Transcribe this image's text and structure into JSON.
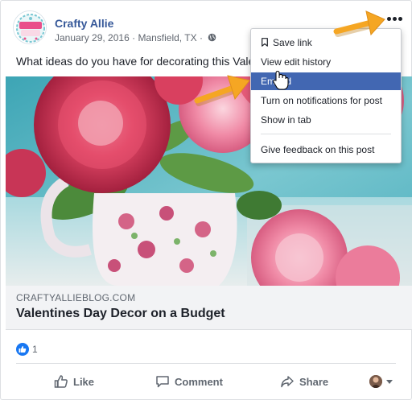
{
  "post": {
    "author": "Crafty Allie",
    "avatar_text": "Crafty Allie",
    "date": "January 29, 2016",
    "separator": "·",
    "location": "Mansfield, TX",
    "text": "What ideas do you have for decorating this Valentine's Day?",
    "more_icon": "more-dots-icon",
    "privacy_icon": "globe-icon"
  },
  "link_preview": {
    "domain": "CRAFTYALLIEBLOG.COM",
    "title": "Valentines Day Decor on a Budget"
  },
  "reactions": {
    "icon": "like-reaction-icon",
    "count": "1"
  },
  "actions": {
    "like": "Like",
    "comment": "Comment",
    "share": "Share"
  },
  "menu": {
    "items": [
      {
        "label": "Save link",
        "icon": "bookmark-icon"
      },
      {
        "label": "View edit history"
      },
      {
        "label": "Embed",
        "state": "hovered"
      },
      {
        "label": "Turn on notifications for post"
      },
      {
        "label": "Show in tab"
      },
      {
        "label": "Give feedback on this post"
      }
    ]
  },
  "colors": {
    "link_blue": "#365899",
    "menu_highlight": "#4267b2",
    "annotation_arrow": "#f5a623",
    "like_blue": "#1877f2"
  }
}
